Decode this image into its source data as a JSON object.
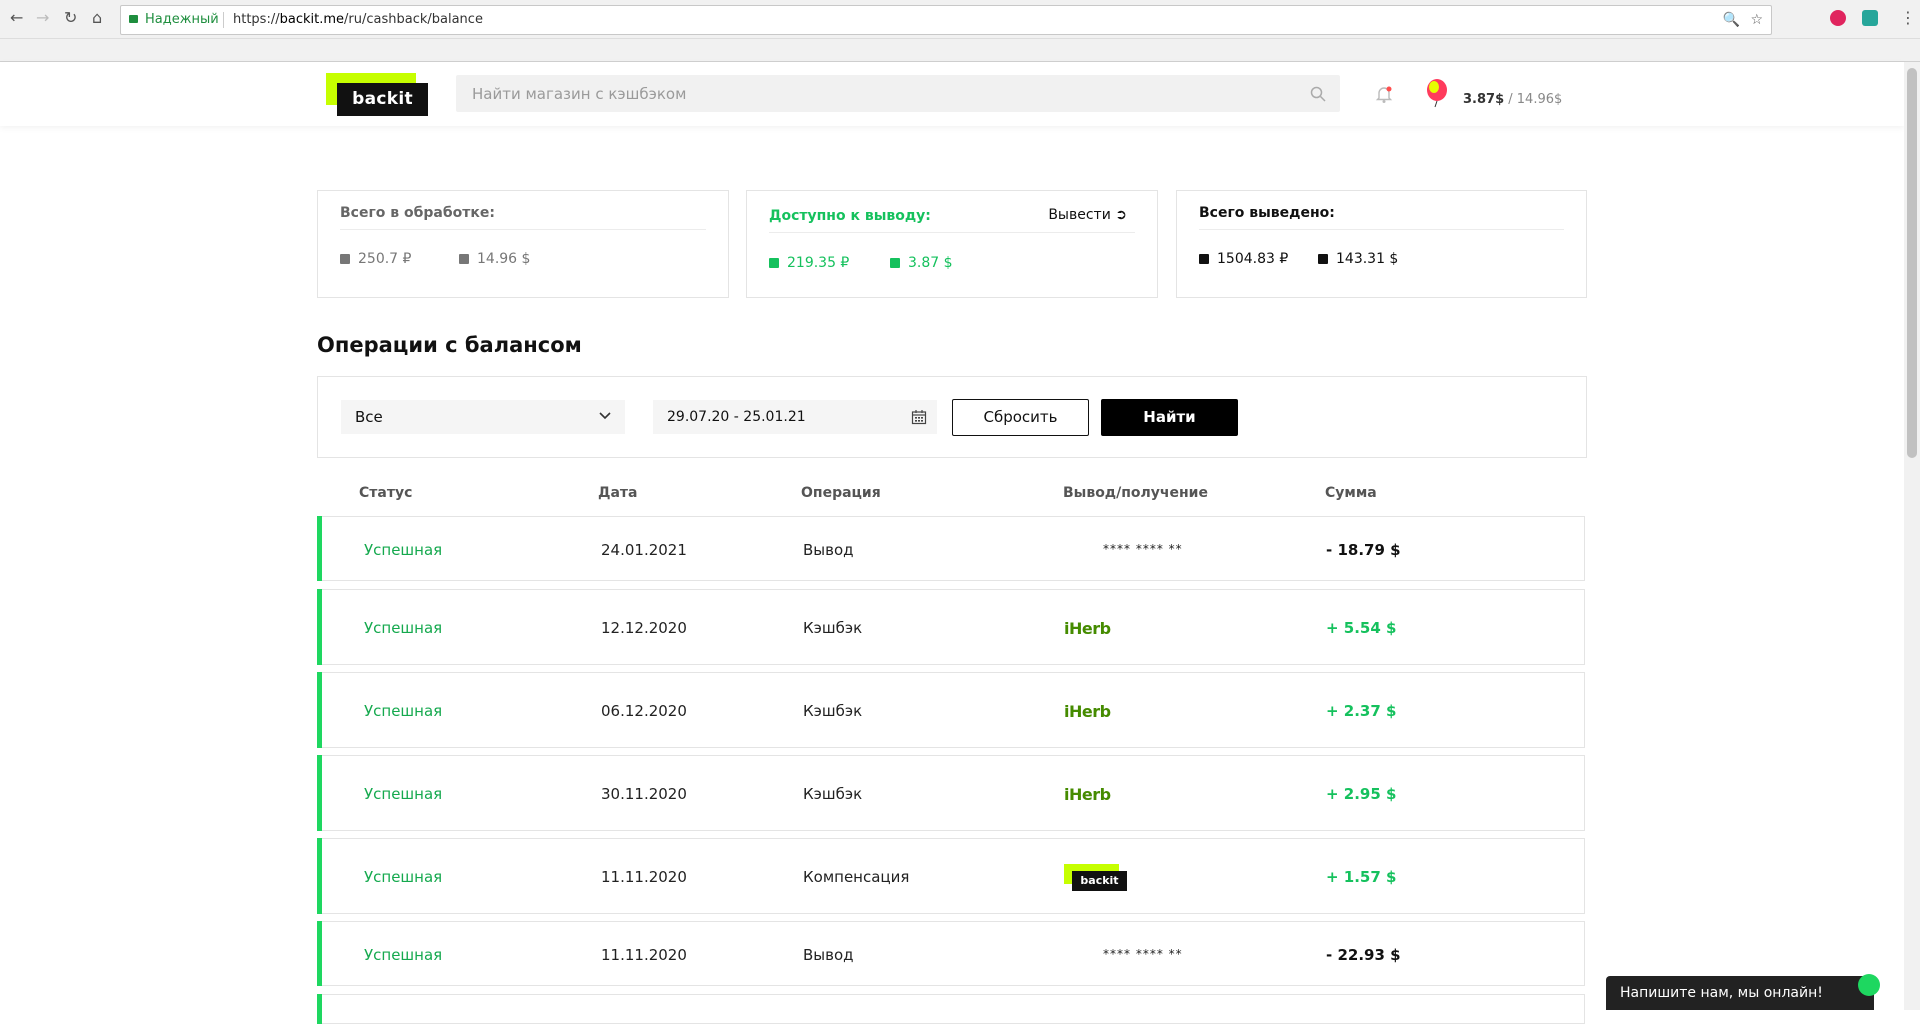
{
  "browser": {
    "secure_label": "Надежный",
    "url_prefix": "https://",
    "url_host": "backit.me",
    "url_path": "/ru/cashback/balance"
  },
  "header": {
    "logo_text": "backit",
    "search_placeholder": "Найти магазин с кэшбэком",
    "balance_available": "3.87$",
    "balance_separator": " / ",
    "balance_total": "14.96$"
  },
  "cards": {
    "processing": {
      "title": "Всего в обработке:",
      "rub": "250.7 ₽",
      "usd": "14.96 $",
      "color": "#777777"
    },
    "available": {
      "title": "Доступно к выводу:",
      "withdraw_label": "Вывести",
      "rub": "219.35 ₽",
      "usd": "3.87 $",
      "color": "#15c15d"
    },
    "withdrawn": {
      "title": "Всего выведено:",
      "rub": "1504.83 ₽",
      "usd": "143.31 $",
      "color": "#111111"
    }
  },
  "operations": {
    "title": "Операции с балансом",
    "filter": {
      "type_selected": "Все",
      "date_range": "29.07.20 - 25.01.21",
      "reset_label": "Сбросить",
      "find_label": "Найти"
    },
    "columns": [
      "Статус",
      "Дата",
      "Операция",
      "Вывод/получение",
      "Сумма"
    ],
    "rows": [
      {
        "status": "Успешная",
        "date": "24.01.2021",
        "operation": "Вывод",
        "target": "**** **** **",
        "target_type": "card",
        "amount": "- 18.79 $",
        "sign": "neg"
      },
      {
        "status": "Успешная",
        "date": "12.12.2020",
        "operation": "Кэшбэк",
        "target": "iHerb",
        "target_type": "store",
        "amount": "+ 5.54 $",
        "sign": "pos"
      },
      {
        "status": "Успешная",
        "date": "06.12.2020",
        "operation": "Кэшбэк",
        "target": "iHerb",
        "target_type": "store",
        "amount": "+ 2.37 $",
        "sign": "pos"
      },
      {
        "status": "Успешная",
        "date": "30.11.2020",
        "operation": "Кэшбэк",
        "target": "iHerb",
        "target_type": "store",
        "amount": "+ 2.95 $",
        "sign": "pos"
      },
      {
        "status": "Успешная",
        "date": "11.11.2020",
        "operation": "Компенсация",
        "target": "backit",
        "target_type": "logo",
        "amount": "+ 1.57 $",
        "sign": "pos"
      },
      {
        "status": "Успешная",
        "date": "11.11.2020",
        "operation": "Вывод",
        "target": "**** **** **",
        "target_type": "card",
        "amount": "- 22.93 $",
        "sign": "neg"
      }
    ]
  },
  "chat": {
    "label": "Напишите нам, мы онлайн!"
  },
  "colors": {
    "accent_lime": "#c6ff00",
    "success_green": "#15c15d",
    "status_bar": "#1ed760"
  }
}
